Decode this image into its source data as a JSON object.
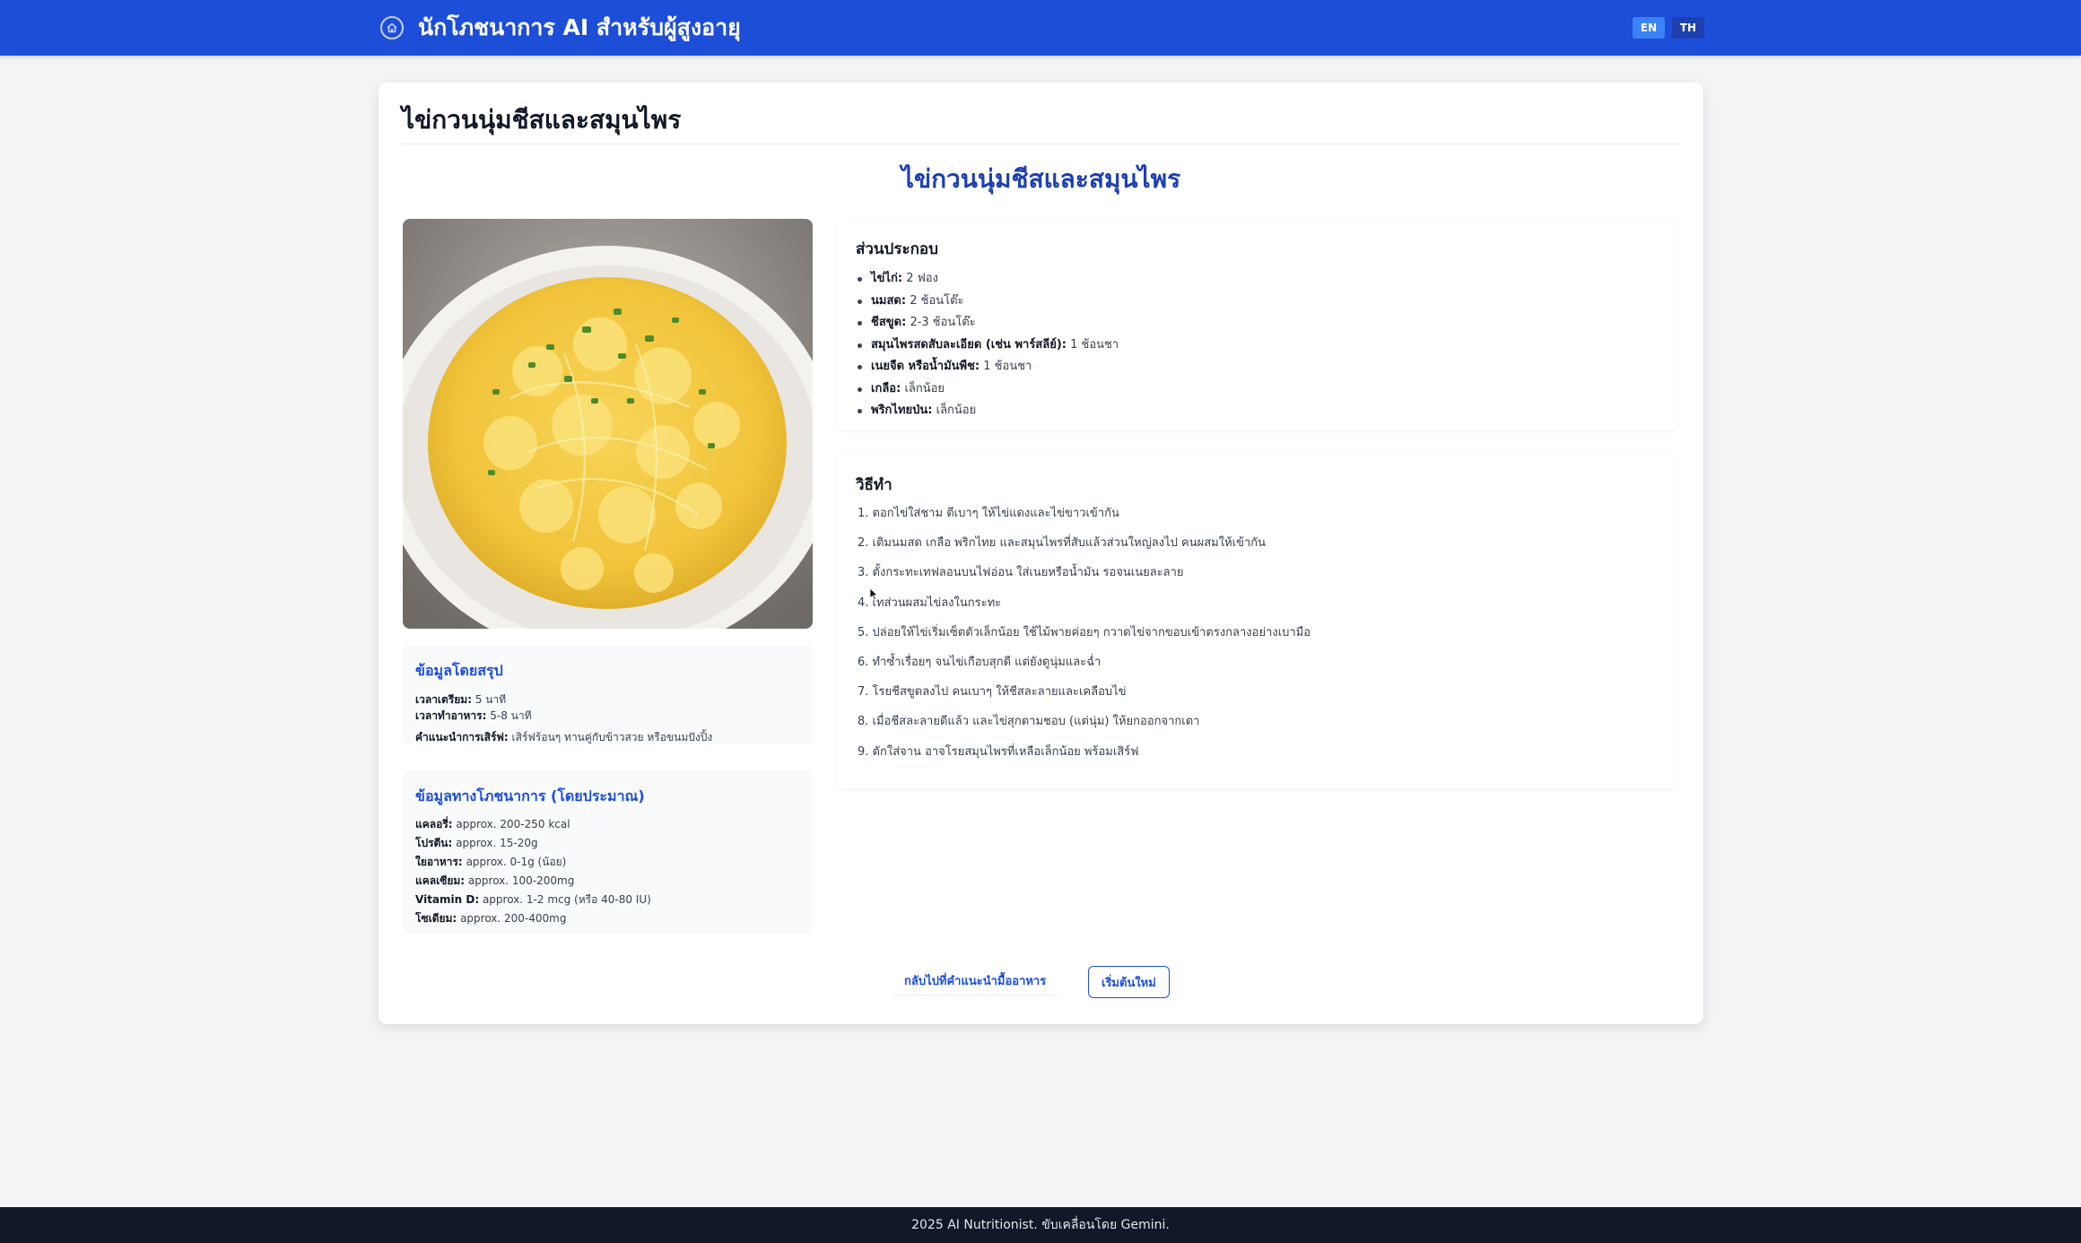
{
  "header": {
    "app_title": "นักโภชนาการ AI สำหรับผู้สูงอายุ",
    "logo_icon": "home-icon",
    "lang_en": "EN",
    "lang_th": "TH"
  },
  "page": {
    "title": "ไข่กวนนุ่มชีสและสมุนไพร",
    "recipe_title": "ไข่กวนนุ่มชีสและสมุนไพร"
  },
  "summary": {
    "heading": "ข้อมูลโดยสรุป",
    "prep_label": "เวลาเตรียม:",
    "prep_value": "5 นาที",
    "cook_label": "เวลาทำอาหาร:",
    "cook_value": "5-8 นาที",
    "serve_label": "คำแนะนำการเสิร์ฟ:",
    "serve_value": "เสิร์ฟร้อนๆ ทานคู่กับข้าวสวย หรือขนมปังปิ้ง"
  },
  "nutrition": {
    "heading": "ข้อมูลทางโภชนาการ (โดยประมาณ)",
    "items": [
      {
        "label": "แคลอรี่:",
        "value": "approx. 200-250 kcal"
      },
      {
        "label": "โปรตีน:",
        "value": "approx. 15-20g"
      },
      {
        "label": "ใยอาหาร:",
        "value": "approx. 0-1g (น้อย)"
      },
      {
        "label": "แคลเซียม:",
        "value": "approx. 100-200mg"
      },
      {
        "label": "Vitamin D:",
        "value": "approx. 1-2 mcg (หรือ 40-80 IU)"
      },
      {
        "label": "โซเดียม:",
        "value": "approx. 200-400mg"
      }
    ]
  },
  "ingredients": {
    "heading": "ส่วนประกอบ",
    "items": [
      {
        "name": "ไข่ไก่:",
        "amount": "2 ฟอง"
      },
      {
        "name": "นมสด:",
        "amount": "2 ช้อนโต๊ะ"
      },
      {
        "name": "ชีสขูด:",
        "amount": "2-3 ช้อนโต๊ะ"
      },
      {
        "name": "สมุนไพรสดสับละเอียด (เช่น พาร์สลีย์):",
        "amount": "1 ช้อนชา"
      },
      {
        "name": "เนยจืด หรือน้ำมันพืช:",
        "amount": "1 ช้อนชา"
      },
      {
        "name": "เกลือ:",
        "amount": "เล็กน้อย"
      },
      {
        "name": "พริกไทยป่น:",
        "amount": "เล็กน้อย"
      }
    ]
  },
  "method": {
    "heading": "วิธีทำ",
    "steps": [
      "1. ตอกไข่ใส่ชาม ตีเบาๆ ให้ไข่แดงและไข่ขาวเข้ากัน",
      "2. เติมนมสด เกลือ พริกไทย และสมุนไพรที่สับแล้วส่วนใหญ่ลงไป คนผสมให้เข้ากัน",
      "3. ตั้งกระทะเทฟลอนบนไฟอ่อน ใส่เนยหรือน้ำมัน รอจนเนยละลาย",
      "4. เทส่วนผสมไข่ลงในกระทะ",
      "5. ปล่อยให้ไข่เริ่มเซ็ตตัวเล็กน้อย ใช้ไม้พายค่อยๆ กวาดไข่จากขอบเข้าตรงกลางอย่างเบามือ",
      "6. ทำซ้ำเรื่อยๆ จนไข่เกือบสุกดี แต่ยังดูนุ่มและฉ่ำ",
      "7. โรยชีสขูดลงไป คนเบาๆ ให้ชีสละลายและเคลือบไข่",
      "8. เมื่อชีสละลายดีแล้ว และไข่สุกตามชอบ (แต่นุ่ม) ให้ยกออกจากเตา",
      "9. ตักใส่จาน อาจโรยสมุนไพรที่เหลือเล็กน้อย พร้อมเสิร์ฟ"
    ]
  },
  "actions": {
    "back_label": "กลับไปที่คำแนะนำมื้ออาหาร",
    "restart_label": "เริ่มต้นใหม่"
  },
  "footer": {
    "text": "2025 AI Nutritionist. ขับเคลื่อนโดย Gemini."
  },
  "colors": {
    "header_bg": "#1d4ed8",
    "accent": "#1e40af",
    "footer_bg": "#111827"
  }
}
